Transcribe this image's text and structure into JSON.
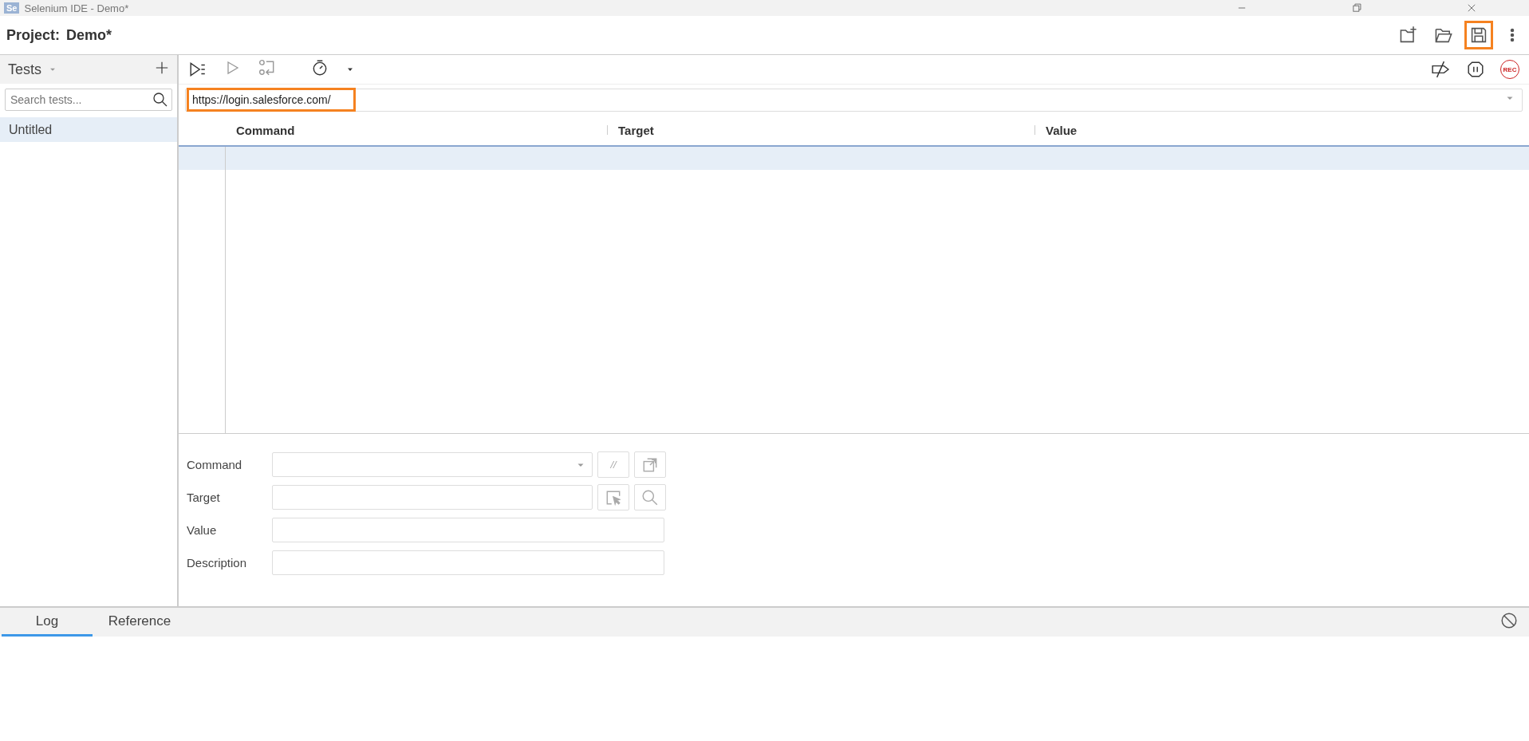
{
  "window": {
    "logo": "Se",
    "title": "Selenium IDE - Demo*"
  },
  "header": {
    "label": "Project:",
    "name": "Demo*"
  },
  "sidebar": {
    "title": "Tests",
    "search": {
      "placeholder": "Search tests..."
    },
    "items": [
      {
        "label": "Untitled",
        "selected": true
      }
    ]
  },
  "record_button": "REC",
  "base_url": {
    "value": "https://login.salesforce.com/"
  },
  "table": {
    "columns": [
      "Command",
      "Target",
      "Value"
    ],
    "rows": [
      {
        "selected": true
      }
    ]
  },
  "editor": {
    "fields": [
      {
        "label": "Command",
        "kind": "select"
      },
      {
        "label": "Target",
        "kind": "target"
      },
      {
        "label": "Value",
        "kind": "text"
      },
      {
        "label": "Description",
        "kind": "text"
      }
    ],
    "comment_button": "//"
  },
  "bottom_tabs": [
    {
      "label": "Log",
      "selected": true
    },
    {
      "label": "Reference",
      "selected": false
    }
  ]
}
